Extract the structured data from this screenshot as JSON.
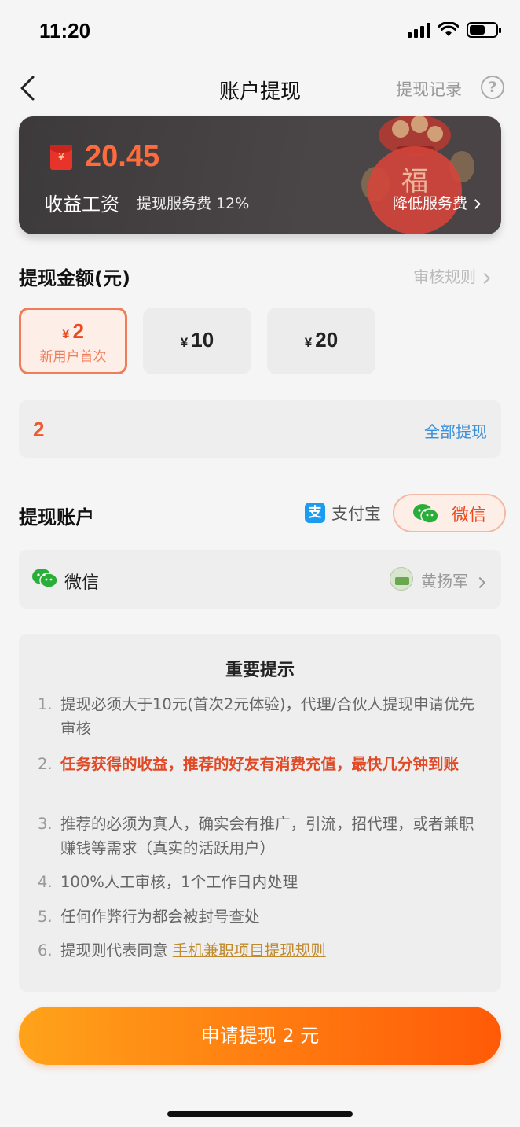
{
  "status_bar": {
    "time": "11:20"
  },
  "nav": {
    "title": "账户提现",
    "records": "提现记录",
    "help": "?"
  },
  "balance": {
    "amount": "20.45",
    "label": "收益工资",
    "fee": "提现服务费 12%",
    "reduce_fee": "降低服务费",
    "bag_char": "福"
  },
  "withdraw": {
    "title": "提现金额(元)",
    "rules": "审核规则",
    "options": [
      {
        "currency": "¥",
        "value": "2",
        "sub": "新用户首次"
      },
      {
        "currency": "¥",
        "value": "10"
      },
      {
        "currency": "¥",
        "value": "20"
      }
    ],
    "input_value": "2",
    "withdraw_all": "全部提现"
  },
  "account": {
    "title": "提现账户",
    "alipay": "支付宝",
    "alipay_icon_char": "支",
    "wechat": "微信",
    "selected_label": "微信",
    "user_name": "黄扬军"
  },
  "tips": {
    "title": "重要提示",
    "items": [
      {
        "no": "1.",
        "text": "提现必须大于10元(首次2元体验)，代理/合伙人提现申请优先审核"
      },
      {
        "no": "2.",
        "text": "任务获得的收益，推荐的好友有消费充值，最快几分钟到账"
      },
      {
        "no": "3.",
        "text": "推荐的必须为真人，确实会有推广，引流，招代理，或者兼职赚钱等需求（真实的活跃用户）"
      },
      {
        "no": "4.",
        "text": "100%人工审核，1个工作日内处理"
      },
      {
        "no": "5.",
        "text": "任何作弊行为都会被封号查处"
      },
      {
        "no": "6.",
        "text": "提现则代表同意",
        "link": "手机兼职项目提现规则"
      }
    ]
  },
  "submit": {
    "label": "申请提现 2 元"
  },
  "colors": {
    "accent": "#ee4a1f",
    "button_start": "#ffa31a",
    "button_end": "#ff5a08",
    "link_blue": "#3b8fd9"
  }
}
